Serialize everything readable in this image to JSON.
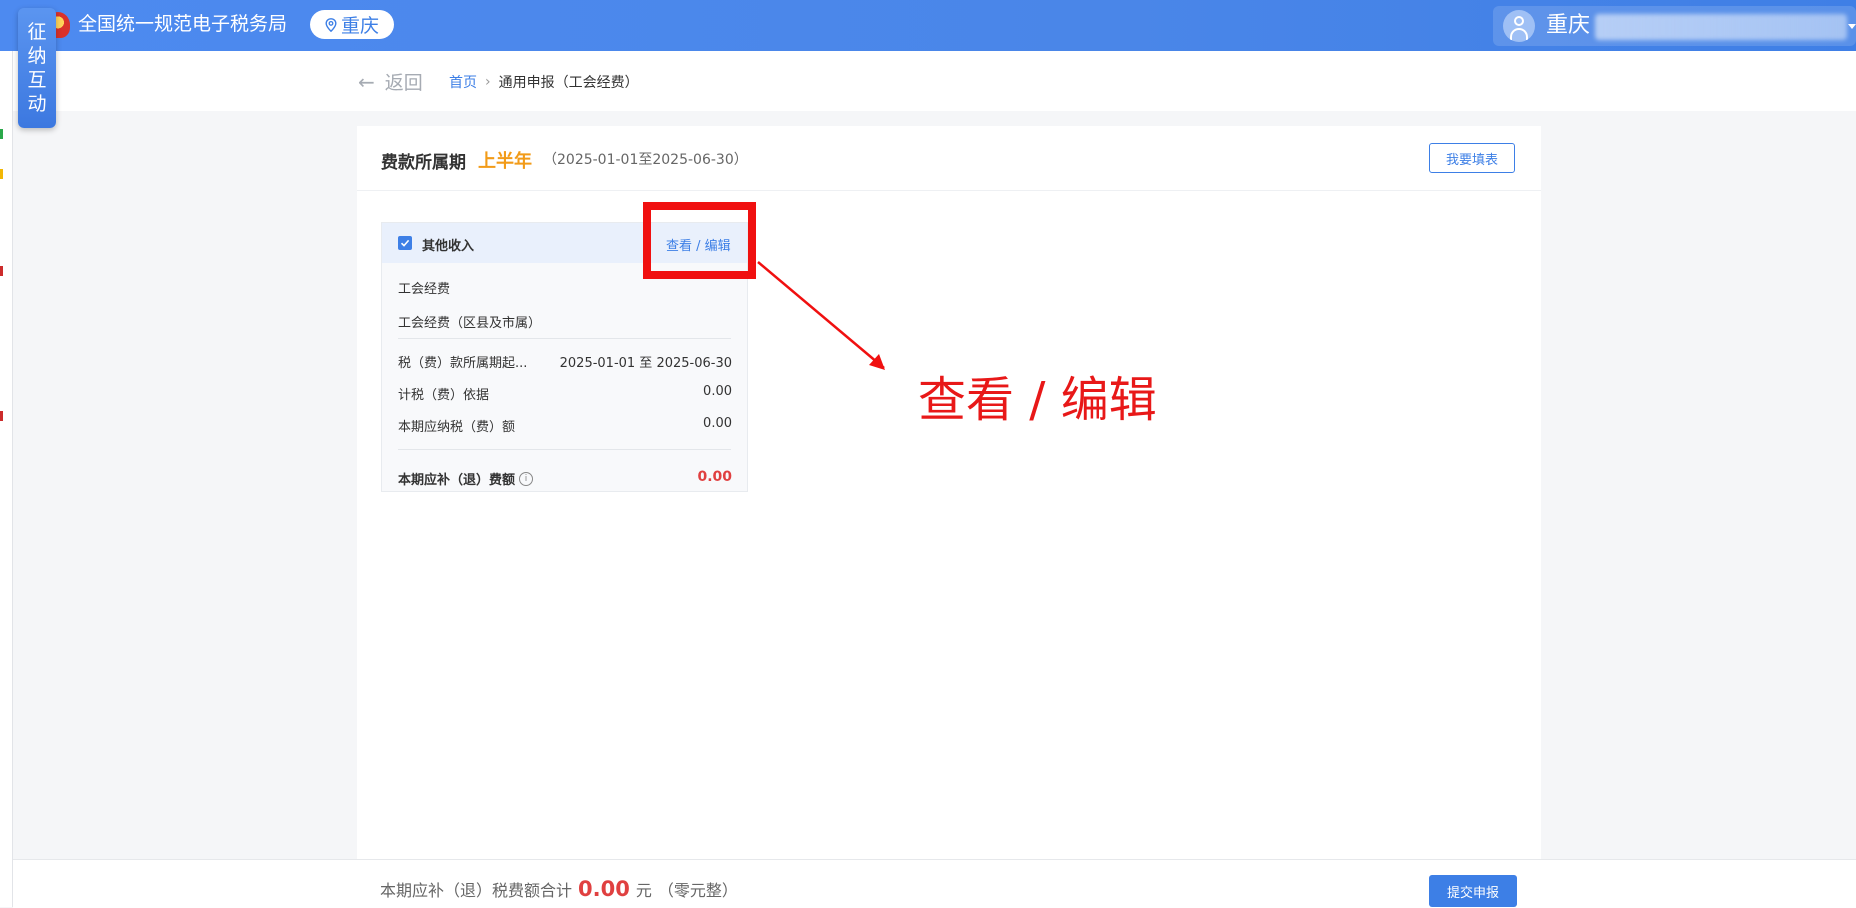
{
  "header": {
    "app_title": "全国统一规范电子税务局",
    "region": "重庆",
    "user_name": "重庆"
  },
  "side_badge": [
    "征",
    "纳",
    "互",
    "动"
  ],
  "breadcrumb": {
    "back_label": "返回",
    "home": "首页",
    "separator": "›",
    "current": "通用申报（工会经费）"
  },
  "period": {
    "label": "费款所属期",
    "value": "上半年",
    "range": "（2025-01-01至2025-06-30）"
  },
  "fill_table_button": "我要填表",
  "income_card": {
    "title": "其他收入",
    "view_edit_link": "查看 / 编辑",
    "item_name": "工会经费",
    "item_subname": "工会经费（区县及市属）",
    "rows": [
      {
        "label": "税（费）款所属期起...",
        "value": "2025-01-01 至 2025-06-30"
      },
      {
        "label": "计税（费）依据",
        "value": "0.00"
      },
      {
        "label": "本期应纳税（费）额",
        "value": "0.00"
      }
    ],
    "total_label": "本期应补（退）费额",
    "total_value": "0.00"
  },
  "annotation": {
    "text": "查看 / 编辑",
    "color": "#e81818"
  },
  "bottom": {
    "summary_prefix": "本期应补（退）税费额合计",
    "amount": "0.00",
    "unit": "元",
    "amount_words": "（零元整）",
    "submit_label": "提交申报"
  },
  "colors": {
    "primary": "#3d7fe6",
    "accent_orange": "#f29b18",
    "amount_red": "#e04040"
  }
}
